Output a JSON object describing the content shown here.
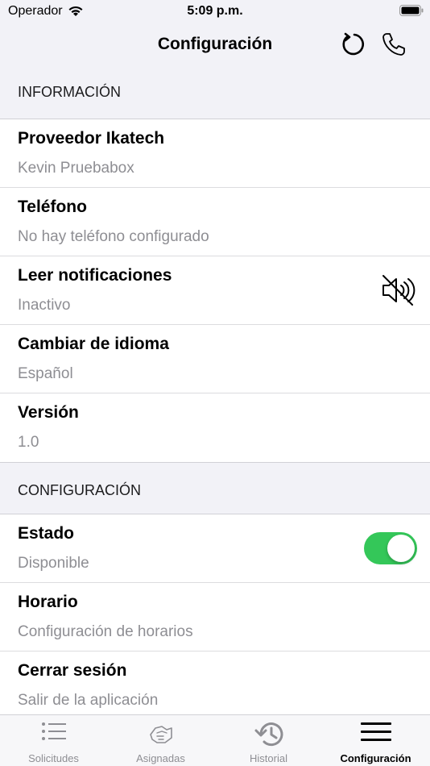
{
  "status_bar": {
    "carrier": "Operador",
    "time": "5:09 p.m."
  },
  "nav": {
    "title": "Configuración",
    "icons": [
      "refresh-icon",
      "phone-icon"
    ]
  },
  "sections": {
    "info": {
      "header": "INFORMACIÓN",
      "rows": [
        {
          "title": "Proveedor Ikatech",
          "value": "Kevin Pruebabox"
        },
        {
          "title": "Teléfono",
          "value": "No hay teléfono configurado"
        },
        {
          "title": "Leer notificaciones",
          "value": "Inactivo",
          "icon": "speaker-muted-icon"
        },
        {
          "title": "Cambiar de idioma",
          "value": "Español"
        },
        {
          "title": "Versión",
          "value": "1.0"
        }
      ]
    },
    "config": {
      "header": "CONFIGURACIÓN",
      "rows": [
        {
          "title": "Estado",
          "value": "Disponible",
          "toggle_on": true
        },
        {
          "title": "Horario",
          "value": "Configuración de horarios"
        },
        {
          "title": "Cerrar sesión",
          "value": "Salir de la aplicación"
        }
      ]
    }
  },
  "tab_bar": {
    "active": "Configuración",
    "tabs": [
      {
        "label": "Solicitudes",
        "icon": "list-icon"
      },
      {
        "label": "Asignadas",
        "icon": "handshake-icon"
      },
      {
        "label": "Historial",
        "icon": "history-icon"
      },
      {
        "label": "Configuración",
        "icon": "menu-icon"
      }
    ]
  },
  "colors": {
    "toggle_on": "#34c759",
    "secondary_text": "#8e8e93",
    "background": "#f2f2f7"
  }
}
